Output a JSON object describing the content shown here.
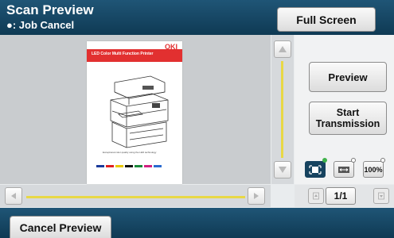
{
  "header": {
    "title": "Scan Preview",
    "subtitle": "●: Job Cancel",
    "full_screen_label": "Full Screen"
  },
  "document": {
    "brand": "OKI",
    "banner_text": "LED Color Multi Function Printer",
    "caption": "Exceptional color quality using the LED technology",
    "color_bar": [
      "#1a3a9a",
      "#e02020",
      "#e8c800",
      "#111111",
      "#1a8a3a",
      "#d02080",
      "#2a6ad0"
    ]
  },
  "actions": {
    "preview_label": "Preview",
    "start_line1": "Start",
    "start_line2": "Transmission"
  },
  "zoom": {
    "options": [
      {
        "name": "fit-page",
        "active": true
      },
      {
        "name": "fit-width",
        "active": false
      },
      {
        "name": "actual-size",
        "label": "100%",
        "active": false
      }
    ]
  },
  "pagination": {
    "counter": "1/1"
  },
  "footer": {
    "cancel_label": "Cancel Preview"
  },
  "colors": {
    "header": "#1a4d6c",
    "scroll_track": "#e8d846",
    "active_zoom": "#16435f",
    "indicator_on": "#3fb24a"
  }
}
